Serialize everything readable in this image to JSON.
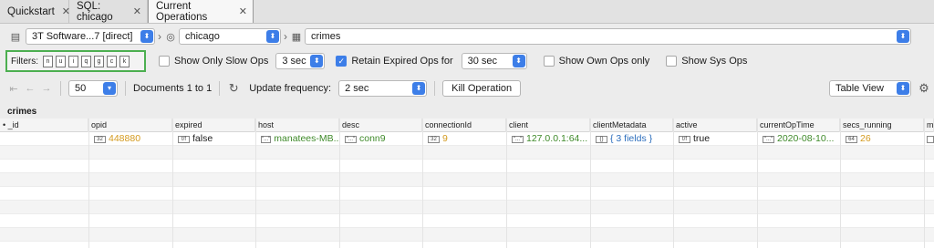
{
  "tabs": [
    {
      "label": "Quickstart",
      "active": false
    },
    {
      "label": "SQL: chicago",
      "active": false
    },
    {
      "label": "Current Operations",
      "active": true
    }
  ],
  "path": {
    "connection": "3T Software...7 [direct]",
    "database": "chicago",
    "collection": "crimes"
  },
  "filters": {
    "label": "Filters:",
    "buttons": [
      "n",
      "u",
      "i",
      "q",
      "g",
      "c",
      "k"
    ],
    "only_slow_label": "Show Only Slow Ops",
    "only_slow_checked": false,
    "slow_threshold": "3 sec",
    "retain_label": "Retain Expired Ops for",
    "retain_checked": true,
    "retain_value": "30 sec",
    "own_ops_label": "Show Own Ops only",
    "own_ops_checked": false,
    "sys_ops_label": "Show Sys Ops",
    "sys_ops_checked": false
  },
  "toolbar": {
    "page_size": "50",
    "documents_label": "Documents 1 to 1",
    "update_label": "Update frequency:",
    "update_value": "2 sec",
    "kill_label": "Kill Operation",
    "view_mode": "Table View"
  },
  "grid": {
    "title": "crimes",
    "columns": [
      "_id",
      "opid",
      "expired",
      "host",
      "desc",
      "connectionId",
      "client",
      "clientMetadata",
      "active",
      "currentOpTime",
      "secs_running",
      "mi"
    ],
    "row": {
      "_id": "",
      "opid": "448880",
      "expired": "false",
      "host": "manatees-MB...",
      "desc": "conn9",
      "connectionId": "9",
      "client": "127.0.0.1:64...",
      "clientMetadata": "{ 3 fields }",
      "active": "true",
      "currentOpTime": "2020-08-10...",
      "secs_running": "26"
    }
  },
  "colors": {
    "number": "#d49a1e",
    "string": "#3f8a2a",
    "object": "#2e6fbd",
    "accent": "#3d7ee8",
    "filter_border": "#4caf50"
  }
}
